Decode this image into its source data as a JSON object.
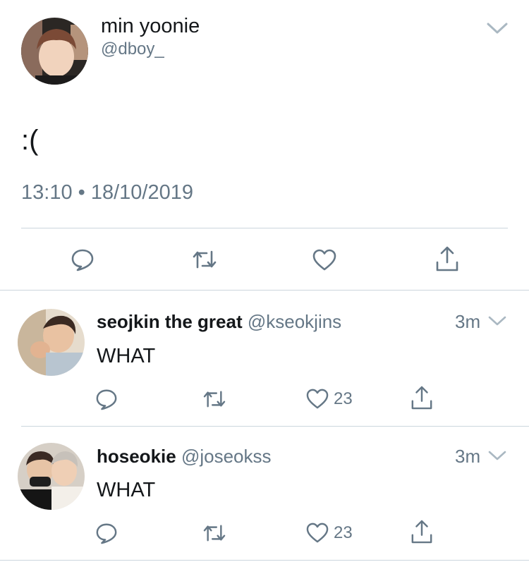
{
  "main_tweet": {
    "display_name": "min yoonie",
    "handle": "@dboy_",
    "text": ":(",
    "time": "13:10",
    "separator": "•",
    "date": "18/10/2019"
  },
  "replies": [
    {
      "display_name": "seojkin the great",
      "handle": "@kseokjins",
      "age": "3m",
      "text": "WHAT",
      "like_count": "23"
    },
    {
      "display_name": "hoseokie",
      "handle": "@joseokss",
      "age": "3m",
      "text": "WHAT",
      "like_count": "23"
    }
  ],
  "icons": {
    "reply": "speech-bubble-icon",
    "retweet": "retweet-arrows-icon",
    "like": "heart-icon",
    "share": "share-upload-icon",
    "more": "chevron-down-icon"
  },
  "colors": {
    "text": "#14171a",
    "muted": "#657786",
    "divider": "#ccd6dd"
  }
}
